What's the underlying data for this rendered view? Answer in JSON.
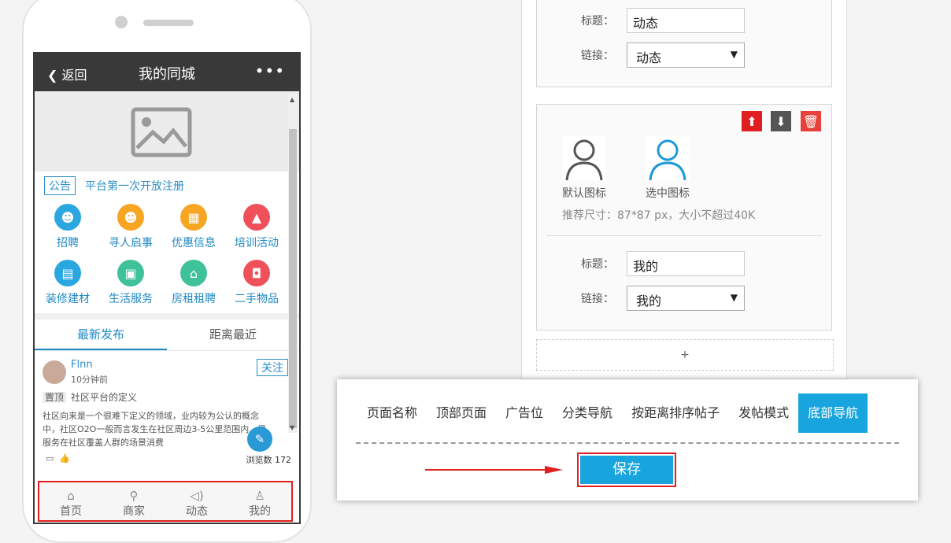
{
  "phone": {
    "back_label": "返回",
    "title": "我的同城",
    "more_label": "•••",
    "notice": {
      "tag": "公告",
      "text": "平台第一次开放注册"
    },
    "categories": [
      {
        "label": "招聘",
        "icon": "person-icon",
        "color": "#2aa7e1"
      },
      {
        "label": "寻人启事",
        "icon": "user-icon",
        "color": "#f6a623"
      },
      {
        "label": "优惠信息",
        "icon": "gift-icon",
        "color": "#f6a623"
      },
      {
        "label": "培训活动",
        "icon": "graduation-cap-icon",
        "color": "#f0505a"
      },
      {
        "label": "装修建材",
        "icon": "basket-icon",
        "color": "#2aa7e1"
      },
      {
        "label": "生活服务",
        "icon": "bag-icon",
        "color": "#3fc29a"
      },
      {
        "label": "房租租聘",
        "icon": "house-icon",
        "color": "#3fc29a"
      },
      {
        "label": "二手物品",
        "icon": "shopping-bag-icon",
        "color": "#f0505a"
      }
    ],
    "tabs": [
      "最新发布",
      "距离最近"
    ],
    "post": {
      "user": "Flnn",
      "time": "10分钟前",
      "follow": "关注",
      "top_tag": "置顶",
      "title": "社区平台的定义",
      "body": "社区向来是一个很难下定义的领域，业内较为公认的概念中，社区O2O一般而言发生在社区周边3-5公里范围内，是服务在社区覆盖人群的场景消费",
      "views": "浏览数 172"
    },
    "bottom_nav": [
      "首页",
      "商家",
      "动态",
      "我的"
    ]
  },
  "panel": {
    "card1": {
      "title_label": "标题：",
      "title_value": "动态",
      "link_label": "链接：",
      "link_value": "动态"
    },
    "card2": {
      "default_icon_label": "默认图标",
      "selected_icon_label": "选中图标",
      "hint": "推荐尺寸：87*87 px，大小不超过40K",
      "title_label": "标题：",
      "title_value": "我的",
      "link_label": "链接：",
      "link_value": "我的"
    },
    "add_label": "+"
  },
  "dialog": {
    "tabs": [
      "页面名称",
      "顶部页面",
      "广告位",
      "分类导航",
      "按距离排序帖子",
      "发帖模式",
      "底部导航"
    ],
    "active_tab": "底部导航",
    "save_label": "保存"
  },
  "colors": {
    "accent": "#18a4dc",
    "highlight_border": "#e02020"
  }
}
